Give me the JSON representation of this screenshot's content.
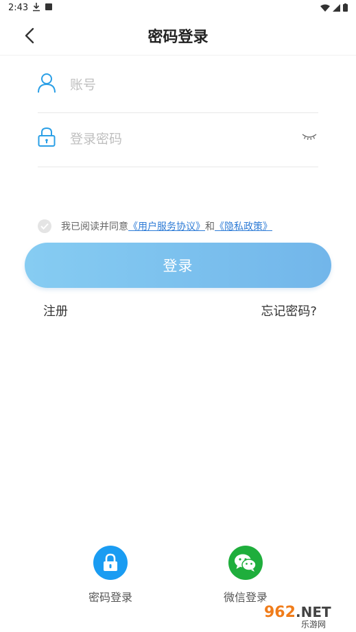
{
  "status_bar": {
    "time": "2:43"
  },
  "header": {
    "title": "密码登录"
  },
  "form": {
    "account_placeholder": "账号",
    "password_placeholder": "登录密码"
  },
  "agreement": {
    "prefix": "我已阅读并同意",
    "user_agreement_link": "《用户服务协议》",
    "conjunction": "和",
    "privacy_link": "《隐私政策》"
  },
  "login_button_label": "登录",
  "links": {
    "register": "注册",
    "forgot_password": "忘记密码?"
  },
  "alt_login": [
    {
      "label": "密码登录",
      "icon": "lock-icon",
      "color": "#1a9cf2"
    },
    {
      "label": "微信登录",
      "icon": "wechat-icon",
      "color": "#1fae3c"
    }
  ],
  "watermark": "962.NET 乐游网",
  "colors": {
    "accent": "#2d7bd6",
    "login_gradient_start": "#86ccf2",
    "login_gradient_end": "#72b6ea",
    "field_icon": "#2a9fe6"
  }
}
